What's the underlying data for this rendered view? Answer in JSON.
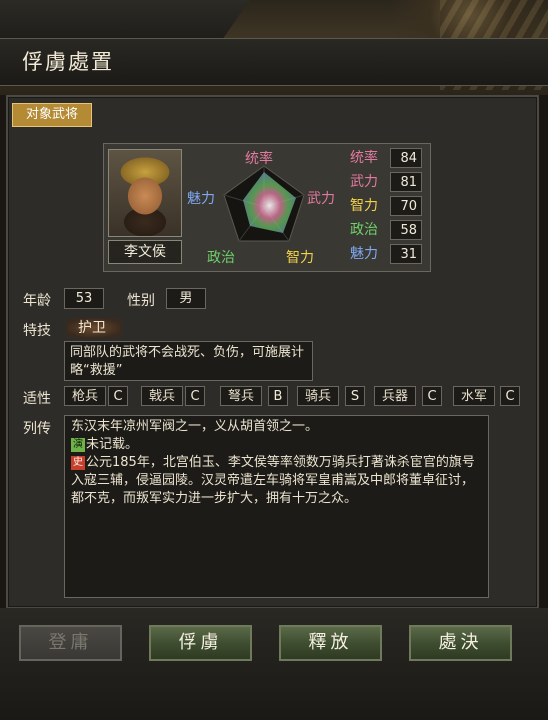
{
  "window": {
    "title": "俘虜處置"
  },
  "target_tab": "对象武将",
  "officer": {
    "name": "李文侯",
    "stats": [
      {
        "label": "统率",
        "value": "84",
        "color": "#e07aa0"
      },
      {
        "label": "武力",
        "value": "81",
        "color": "#e07aa0"
      },
      {
        "label": "智力",
        "value": "70",
        "color": "#f2d24a"
      },
      {
        "label": "政治",
        "value": "58",
        "color": "#6fd06a"
      },
      {
        "label": "魅力",
        "value": "31",
        "color": "#7fa8f0"
      }
    ],
    "radar_labels": {
      "top": "统率",
      "right": "武力",
      "bottom_right": "智力",
      "bottom_left": "政治",
      "left": "魅力"
    },
    "age_label": "年龄",
    "age": "53",
    "gender_label": "性别",
    "gender": "男",
    "skill_label": "特技",
    "skill": "护卫",
    "skill_desc": "同部队的武将不会战死、负伤，可施展计略“救援”",
    "aptitude_label": "适性",
    "aptitudes": [
      {
        "label": "枪兵",
        "value": "C"
      },
      {
        "label": "戟兵",
        "value": "C"
      },
      {
        "label": "弩兵",
        "value": "B"
      },
      {
        "label": "骑兵",
        "value": "S"
      },
      {
        "label": "兵器",
        "value": "C"
      },
      {
        "label": "水军",
        "value": "C"
      }
    ],
    "bio_label": "列传",
    "bio": {
      "line1": "东汉末年凉州军阀之一，义从胡首领之一。",
      "badge_yan": "演",
      "line2": "未记载。",
      "badge_shi": "史",
      "line3": "公元185年，北宫伯玉、李文侯等率领数万骑兵打著诛杀宦官的旗号入寇三辅，侵逼园陵。汉灵帝遣左车骑将军皇甫嵩及中郎将董卓征讨，都不克，而叛军实力进一步扩大，拥有十万之众。"
    }
  },
  "buttons": {
    "recruit": "登庸",
    "capture": "俘虜",
    "release": "釋放",
    "execute": "處決"
  }
}
